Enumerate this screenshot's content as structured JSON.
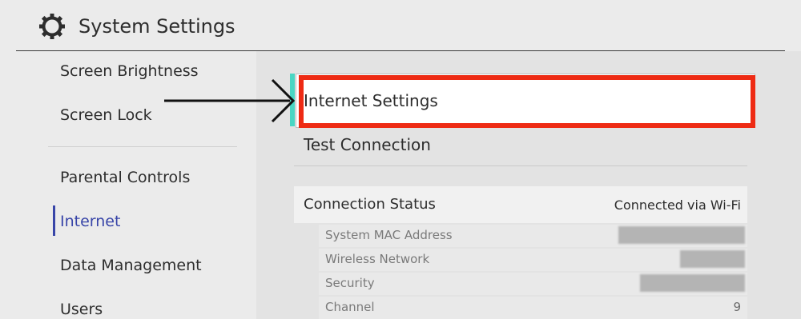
{
  "header": {
    "title": "System Settings",
    "icon": "gear-icon"
  },
  "sidebar": {
    "items": [
      {
        "label": "Screen Brightness"
      },
      {
        "label": "Screen Lock"
      },
      {
        "label": "Parental Controls"
      },
      {
        "label": "Internet"
      },
      {
        "label": "Data Management"
      },
      {
        "label": "Users"
      }
    ],
    "active": "Internet"
  },
  "main": {
    "menu": [
      {
        "label": "Internet Settings",
        "selected": true
      },
      {
        "label": "Test Connection"
      }
    ],
    "status": {
      "label": "Connection Status",
      "value": "Connected via Wi-Fi"
    },
    "details": [
      {
        "label": "System MAC Address",
        "value": ""
      },
      {
        "label": "Wireless Network",
        "value": ""
      },
      {
        "label": "Security",
        "value": ""
      },
      {
        "label": "Channel",
        "value": "9"
      }
    ]
  },
  "colors": {
    "accent": "#3845a8",
    "highlight_box": "#ee2b14",
    "cursor_edge": "#49d6c3"
  }
}
